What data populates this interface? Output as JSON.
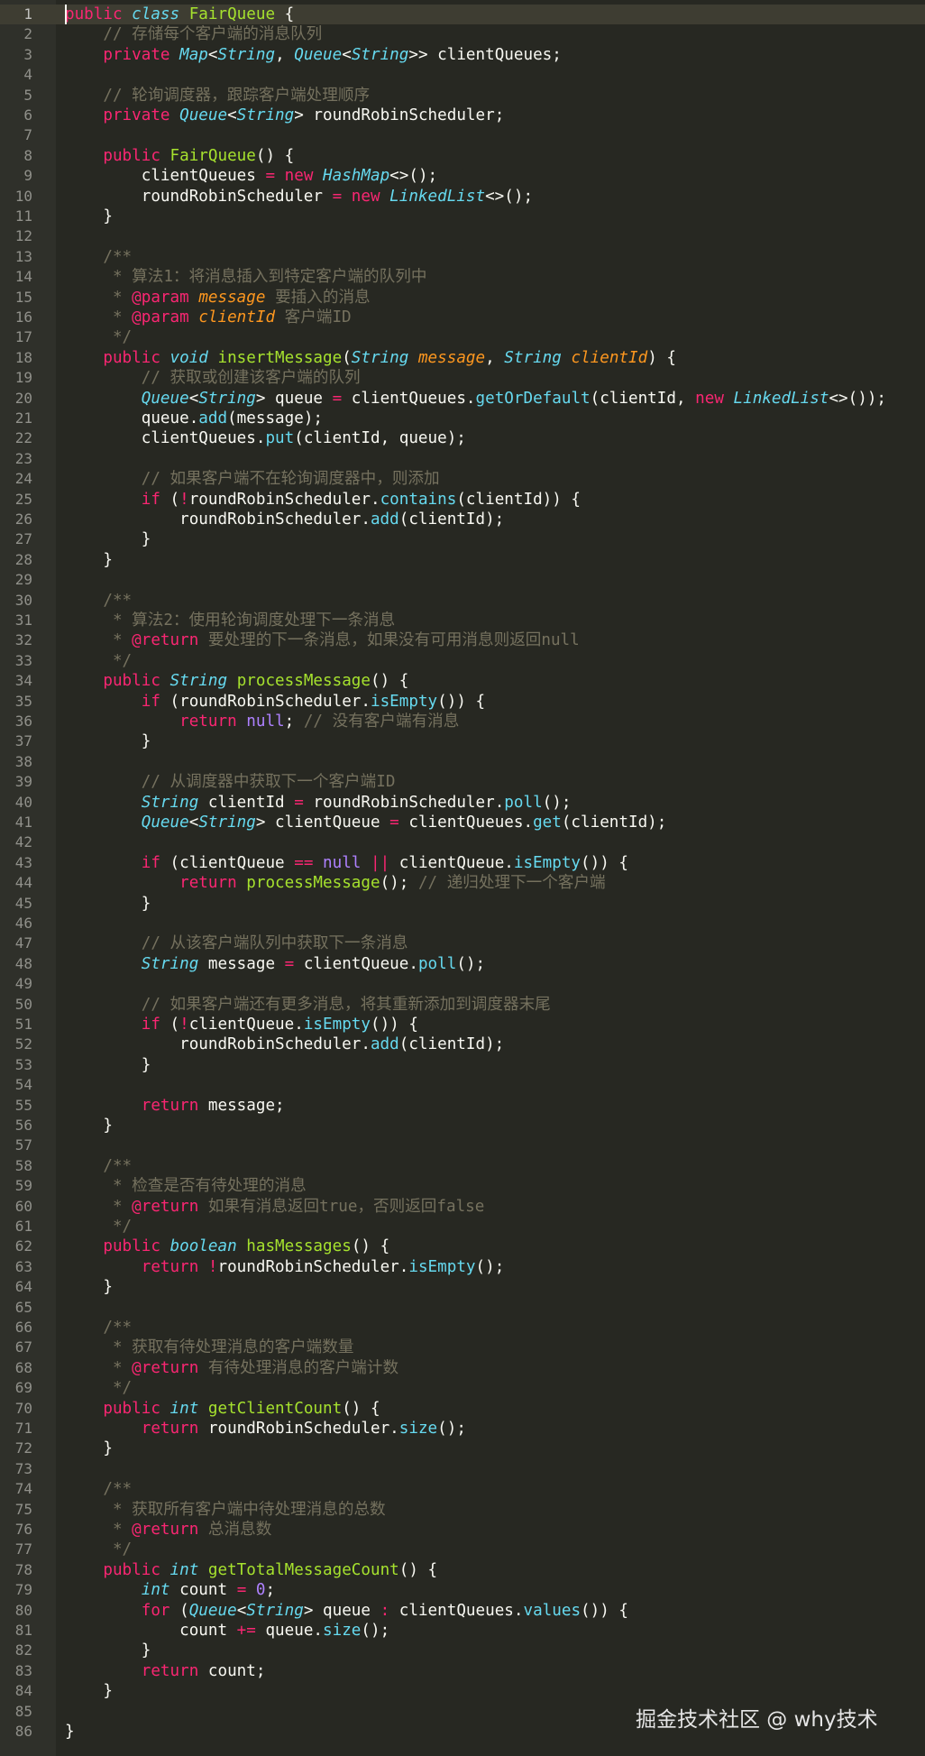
{
  "editor": {
    "theme": "monokai",
    "colors": {
      "background": "#272822",
      "keyword": "#f92672",
      "type": "#66d9ef",
      "function": "#a6e22e",
      "parameter": "#fd971f",
      "comment": "#75715e",
      "constant": "#ae81ff",
      "text": "#f8f8f2"
    },
    "current_line": 1,
    "lines": [
      [
        [
          "kw",
          "public"
        ],
        [
          "pl",
          " "
        ],
        [
          "st",
          "class"
        ],
        [
          "pl",
          " "
        ],
        [
          "fn",
          "FairQueue"
        ],
        [
          "pl",
          " {"
        ]
      ],
      [
        [
          "pl",
          "    "
        ],
        [
          "cm",
          "// 存储每个客户端的消息队列"
        ]
      ],
      [
        [
          "pl",
          "    "
        ],
        [
          "kw",
          "private"
        ],
        [
          "pl",
          " "
        ],
        [
          "st",
          "Map"
        ],
        [
          "pl",
          "<"
        ],
        [
          "st",
          "String"
        ],
        [
          "pl",
          ", "
        ],
        [
          "st",
          "Queue"
        ],
        [
          "pl",
          "<"
        ],
        [
          "st",
          "String"
        ],
        [
          "pl",
          ">> clientQueues;"
        ]
      ],
      [],
      [
        [
          "pl",
          "    "
        ],
        [
          "cm",
          "// 轮询调度器，跟踪客户端处理顺序"
        ]
      ],
      [
        [
          "pl",
          "    "
        ],
        [
          "kw",
          "private"
        ],
        [
          "pl",
          " "
        ],
        [
          "st",
          "Queue"
        ],
        [
          "pl",
          "<"
        ],
        [
          "st",
          "String"
        ],
        [
          "pl",
          "> roundRobinScheduler;"
        ]
      ],
      [],
      [
        [
          "pl",
          "    "
        ],
        [
          "kw",
          "public"
        ],
        [
          "pl",
          " "
        ],
        [
          "fn",
          "FairQueue"
        ],
        [
          "pl",
          "() {"
        ]
      ],
      [
        [
          "pl",
          "        clientQueues "
        ],
        [
          "op",
          "="
        ],
        [
          "pl",
          " "
        ],
        [
          "kw",
          "new"
        ],
        [
          "pl",
          " "
        ],
        [
          "st",
          "HashMap"
        ],
        [
          "pl",
          "<>();"
        ]
      ],
      [
        [
          "pl",
          "        roundRobinScheduler "
        ],
        [
          "op",
          "="
        ],
        [
          "pl",
          " "
        ],
        [
          "kw",
          "new"
        ],
        [
          "pl",
          " "
        ],
        [
          "st",
          "LinkedList"
        ],
        [
          "pl",
          "<>();"
        ]
      ],
      [
        [
          "pl",
          "    }"
        ]
      ],
      [],
      [
        [
          "pl",
          "    "
        ],
        [
          "cm",
          "/**"
        ]
      ],
      [
        [
          "pl",
          "    "
        ],
        [
          "cm",
          " * 算法1：将消息插入到特定客户端的队列中"
        ]
      ],
      [
        [
          "pl",
          "    "
        ],
        [
          "cm",
          " * "
        ],
        [
          "kw",
          "@param"
        ],
        [
          "pl",
          " "
        ],
        [
          "pa",
          "message"
        ],
        [
          "pl",
          " "
        ],
        [
          "cm",
          "要插入的消息"
        ]
      ],
      [
        [
          "pl",
          "    "
        ],
        [
          "cm",
          " * "
        ],
        [
          "kw",
          "@param"
        ],
        [
          "pl",
          " "
        ],
        [
          "pa",
          "clientId"
        ],
        [
          "pl",
          " "
        ],
        [
          "cm",
          "客户端ID"
        ]
      ],
      [
        [
          "pl",
          "    "
        ],
        [
          "cm",
          " */"
        ]
      ],
      [
        [
          "pl",
          "    "
        ],
        [
          "kw",
          "public"
        ],
        [
          "pl",
          " "
        ],
        [
          "st",
          "void"
        ],
        [
          "pl",
          " "
        ],
        [
          "fn",
          "insertMessage"
        ],
        [
          "pl",
          "("
        ],
        [
          "st",
          "String"
        ],
        [
          "pl",
          " "
        ],
        [
          "pa",
          "message"
        ],
        [
          "pl",
          ", "
        ],
        [
          "st",
          "String"
        ],
        [
          "pl",
          " "
        ],
        [
          "pa",
          "clientId"
        ],
        [
          "pl",
          ") {"
        ]
      ],
      [
        [
          "pl",
          "        "
        ],
        [
          "cm",
          "// 获取或创建该客户端的队列"
        ]
      ],
      [
        [
          "pl",
          "        "
        ],
        [
          "st",
          "Queue"
        ],
        [
          "pl",
          "<"
        ],
        [
          "st",
          "String"
        ],
        [
          "pl",
          "> queue "
        ],
        [
          "op",
          "="
        ],
        [
          "pl",
          " clientQueues."
        ],
        [
          "ca",
          "getOrDefault"
        ],
        [
          "pl",
          "(clientId, "
        ],
        [
          "kw",
          "new"
        ],
        [
          "pl",
          " "
        ],
        [
          "st",
          "LinkedList"
        ],
        [
          "pl",
          "<>());"
        ]
      ],
      [
        [
          "pl",
          "        queue."
        ],
        [
          "ca",
          "add"
        ],
        [
          "pl",
          "(message);"
        ]
      ],
      [
        [
          "pl",
          "        clientQueues."
        ],
        [
          "ca",
          "put"
        ],
        [
          "pl",
          "(clientId, queue);"
        ]
      ],
      [],
      [
        [
          "pl",
          "        "
        ],
        [
          "cm",
          "// 如果客户端不在轮询调度器中，则添加"
        ]
      ],
      [
        [
          "pl",
          "        "
        ],
        [
          "kw",
          "if"
        ],
        [
          "pl",
          " ("
        ],
        [
          "op",
          "!"
        ],
        [
          "pl",
          "roundRobinScheduler."
        ],
        [
          "ca",
          "contains"
        ],
        [
          "pl",
          "(clientId)) {"
        ]
      ],
      [
        [
          "pl",
          "            roundRobinScheduler."
        ],
        [
          "ca",
          "add"
        ],
        [
          "pl",
          "(clientId);"
        ]
      ],
      [
        [
          "pl",
          "        }"
        ]
      ],
      [
        [
          "pl",
          "    }"
        ]
      ],
      [],
      [
        [
          "pl",
          "    "
        ],
        [
          "cm",
          "/**"
        ]
      ],
      [
        [
          "pl",
          "    "
        ],
        [
          "cm",
          " * 算法2：使用轮询调度处理下一条消息"
        ]
      ],
      [
        [
          "pl",
          "    "
        ],
        [
          "cm",
          " * "
        ],
        [
          "kw",
          "@return"
        ],
        [
          "pl",
          " "
        ],
        [
          "cm",
          "要处理的下一条消息，如果没有可用消息则返回null"
        ]
      ],
      [
        [
          "pl",
          "    "
        ],
        [
          "cm",
          " */"
        ]
      ],
      [
        [
          "pl",
          "    "
        ],
        [
          "kw",
          "public"
        ],
        [
          "pl",
          " "
        ],
        [
          "st",
          "String"
        ],
        [
          "pl",
          " "
        ],
        [
          "fn",
          "processMessage"
        ],
        [
          "pl",
          "() {"
        ]
      ],
      [
        [
          "pl",
          "        "
        ],
        [
          "kw",
          "if"
        ],
        [
          "pl",
          " (roundRobinScheduler."
        ],
        [
          "ca",
          "isEmpty"
        ],
        [
          "pl",
          "()) {"
        ]
      ],
      [
        [
          "pl",
          "            "
        ],
        [
          "kw",
          "return"
        ],
        [
          "pl",
          " "
        ],
        [
          "cn",
          "null"
        ],
        [
          "pl",
          "; "
        ],
        [
          "cm",
          "// 没有客户端有消息"
        ]
      ],
      [
        [
          "pl",
          "        }"
        ]
      ],
      [],
      [
        [
          "pl",
          "        "
        ],
        [
          "cm",
          "// 从调度器中获取下一个客户端ID"
        ]
      ],
      [
        [
          "pl",
          "        "
        ],
        [
          "st",
          "String"
        ],
        [
          "pl",
          " clientId "
        ],
        [
          "op",
          "="
        ],
        [
          "pl",
          " roundRobinScheduler."
        ],
        [
          "ca",
          "poll"
        ],
        [
          "pl",
          "();"
        ]
      ],
      [
        [
          "pl",
          "        "
        ],
        [
          "st",
          "Queue"
        ],
        [
          "pl",
          "<"
        ],
        [
          "st",
          "String"
        ],
        [
          "pl",
          "> clientQueue "
        ],
        [
          "op",
          "="
        ],
        [
          "pl",
          " clientQueues."
        ],
        [
          "ca",
          "get"
        ],
        [
          "pl",
          "(clientId);"
        ]
      ],
      [],
      [
        [
          "pl",
          "        "
        ],
        [
          "kw",
          "if"
        ],
        [
          "pl",
          " (clientQueue "
        ],
        [
          "op",
          "=="
        ],
        [
          "pl",
          " "
        ],
        [
          "cn",
          "null"
        ],
        [
          "pl",
          " "
        ],
        [
          "op",
          "||"
        ],
        [
          "pl",
          " clientQueue."
        ],
        [
          "ca",
          "isEmpty"
        ],
        [
          "pl",
          "()) {"
        ]
      ],
      [
        [
          "pl",
          "            "
        ],
        [
          "kw",
          "return"
        ],
        [
          "pl",
          " "
        ],
        [
          "fn",
          "processMessage"
        ],
        [
          "pl",
          "(); "
        ],
        [
          "cm",
          "// 递归处理下一个客户端"
        ]
      ],
      [
        [
          "pl",
          "        }"
        ]
      ],
      [],
      [
        [
          "pl",
          "        "
        ],
        [
          "cm",
          "// 从该客户端队列中获取下一条消息"
        ]
      ],
      [
        [
          "pl",
          "        "
        ],
        [
          "st",
          "String"
        ],
        [
          "pl",
          " message "
        ],
        [
          "op",
          "="
        ],
        [
          "pl",
          " clientQueue."
        ],
        [
          "ca",
          "poll"
        ],
        [
          "pl",
          "();"
        ]
      ],
      [],
      [
        [
          "pl",
          "        "
        ],
        [
          "cm",
          "// 如果客户端还有更多消息，将其重新添加到调度器末尾"
        ]
      ],
      [
        [
          "pl",
          "        "
        ],
        [
          "kw",
          "if"
        ],
        [
          "pl",
          " ("
        ],
        [
          "op",
          "!"
        ],
        [
          "pl",
          "clientQueue."
        ],
        [
          "ca",
          "isEmpty"
        ],
        [
          "pl",
          "()) {"
        ]
      ],
      [
        [
          "pl",
          "            roundRobinScheduler."
        ],
        [
          "ca",
          "add"
        ],
        [
          "pl",
          "(clientId);"
        ]
      ],
      [
        [
          "pl",
          "        }"
        ]
      ],
      [],
      [
        [
          "pl",
          "        "
        ],
        [
          "kw",
          "return"
        ],
        [
          "pl",
          " message;"
        ]
      ],
      [
        [
          "pl",
          "    }"
        ]
      ],
      [],
      [
        [
          "pl",
          "    "
        ],
        [
          "cm",
          "/**"
        ]
      ],
      [
        [
          "pl",
          "    "
        ],
        [
          "cm",
          " * 检查是否有待处理的消息"
        ]
      ],
      [
        [
          "pl",
          "    "
        ],
        [
          "cm",
          " * "
        ],
        [
          "kw",
          "@return"
        ],
        [
          "pl",
          " "
        ],
        [
          "cm",
          "如果有消息返回true，否则返回false"
        ]
      ],
      [
        [
          "pl",
          "    "
        ],
        [
          "cm",
          " */"
        ]
      ],
      [
        [
          "pl",
          "    "
        ],
        [
          "kw",
          "public"
        ],
        [
          "pl",
          " "
        ],
        [
          "st",
          "boolean"
        ],
        [
          "pl",
          " "
        ],
        [
          "fn",
          "hasMessages"
        ],
        [
          "pl",
          "() {"
        ]
      ],
      [
        [
          "pl",
          "        "
        ],
        [
          "kw",
          "return"
        ],
        [
          "pl",
          " "
        ],
        [
          "op",
          "!"
        ],
        [
          "pl",
          "roundRobinScheduler."
        ],
        [
          "ca",
          "isEmpty"
        ],
        [
          "pl",
          "();"
        ]
      ],
      [
        [
          "pl",
          "    }"
        ]
      ],
      [],
      [
        [
          "pl",
          "    "
        ],
        [
          "cm",
          "/**"
        ]
      ],
      [
        [
          "pl",
          "    "
        ],
        [
          "cm",
          " * 获取有待处理消息的客户端数量"
        ]
      ],
      [
        [
          "pl",
          "    "
        ],
        [
          "cm",
          " * "
        ],
        [
          "kw",
          "@return"
        ],
        [
          "pl",
          " "
        ],
        [
          "cm",
          "有待处理消息的客户端计数"
        ]
      ],
      [
        [
          "pl",
          "    "
        ],
        [
          "cm",
          " */"
        ]
      ],
      [
        [
          "pl",
          "    "
        ],
        [
          "kw",
          "public"
        ],
        [
          "pl",
          " "
        ],
        [
          "st",
          "int"
        ],
        [
          "pl",
          " "
        ],
        [
          "fn",
          "getClientCount"
        ],
        [
          "pl",
          "() {"
        ]
      ],
      [
        [
          "pl",
          "        "
        ],
        [
          "kw",
          "return"
        ],
        [
          "pl",
          " roundRobinScheduler."
        ],
        [
          "ca",
          "size"
        ],
        [
          "pl",
          "();"
        ]
      ],
      [
        [
          "pl",
          "    }"
        ]
      ],
      [],
      [
        [
          "pl",
          "    "
        ],
        [
          "cm",
          "/**"
        ]
      ],
      [
        [
          "pl",
          "    "
        ],
        [
          "cm",
          " * 获取所有客户端中待处理消息的总数"
        ]
      ],
      [
        [
          "pl",
          "    "
        ],
        [
          "cm",
          " * "
        ],
        [
          "kw",
          "@return"
        ],
        [
          "pl",
          " "
        ],
        [
          "cm",
          "总消息数"
        ]
      ],
      [
        [
          "pl",
          "    "
        ],
        [
          "cm",
          " */"
        ]
      ],
      [
        [
          "pl",
          "    "
        ],
        [
          "kw",
          "public"
        ],
        [
          "pl",
          " "
        ],
        [
          "st",
          "int"
        ],
        [
          "pl",
          " "
        ],
        [
          "fn",
          "getTotalMessageCount"
        ],
        [
          "pl",
          "() {"
        ]
      ],
      [
        [
          "pl",
          "        "
        ],
        [
          "st",
          "int"
        ],
        [
          "pl",
          " count "
        ],
        [
          "op",
          "="
        ],
        [
          "pl",
          " "
        ],
        [
          "cn",
          "0"
        ],
        [
          "pl",
          ";"
        ]
      ],
      [
        [
          "pl",
          "        "
        ],
        [
          "kw",
          "for"
        ],
        [
          "pl",
          " ("
        ],
        [
          "st",
          "Queue"
        ],
        [
          "pl",
          "<"
        ],
        [
          "st",
          "String"
        ],
        [
          "pl",
          "> queue "
        ],
        [
          "op",
          ":"
        ],
        [
          "pl",
          " clientQueues."
        ],
        [
          "ca",
          "values"
        ],
        [
          "pl",
          "()) {"
        ]
      ],
      [
        [
          "pl",
          "            count "
        ],
        [
          "op",
          "+="
        ],
        [
          "pl",
          " queue."
        ],
        [
          "ca",
          "size"
        ],
        [
          "pl",
          "();"
        ]
      ],
      [
        [
          "pl",
          "        }"
        ]
      ],
      [
        [
          "pl",
          "        "
        ],
        [
          "kw",
          "return"
        ],
        [
          "pl",
          " count;"
        ]
      ],
      [
        [
          "pl",
          "    }"
        ]
      ],
      [],
      [
        [
          "pl",
          "}"
        ]
      ]
    ]
  },
  "watermark": {
    "text": "掘金技术社区 @ why技术"
  }
}
